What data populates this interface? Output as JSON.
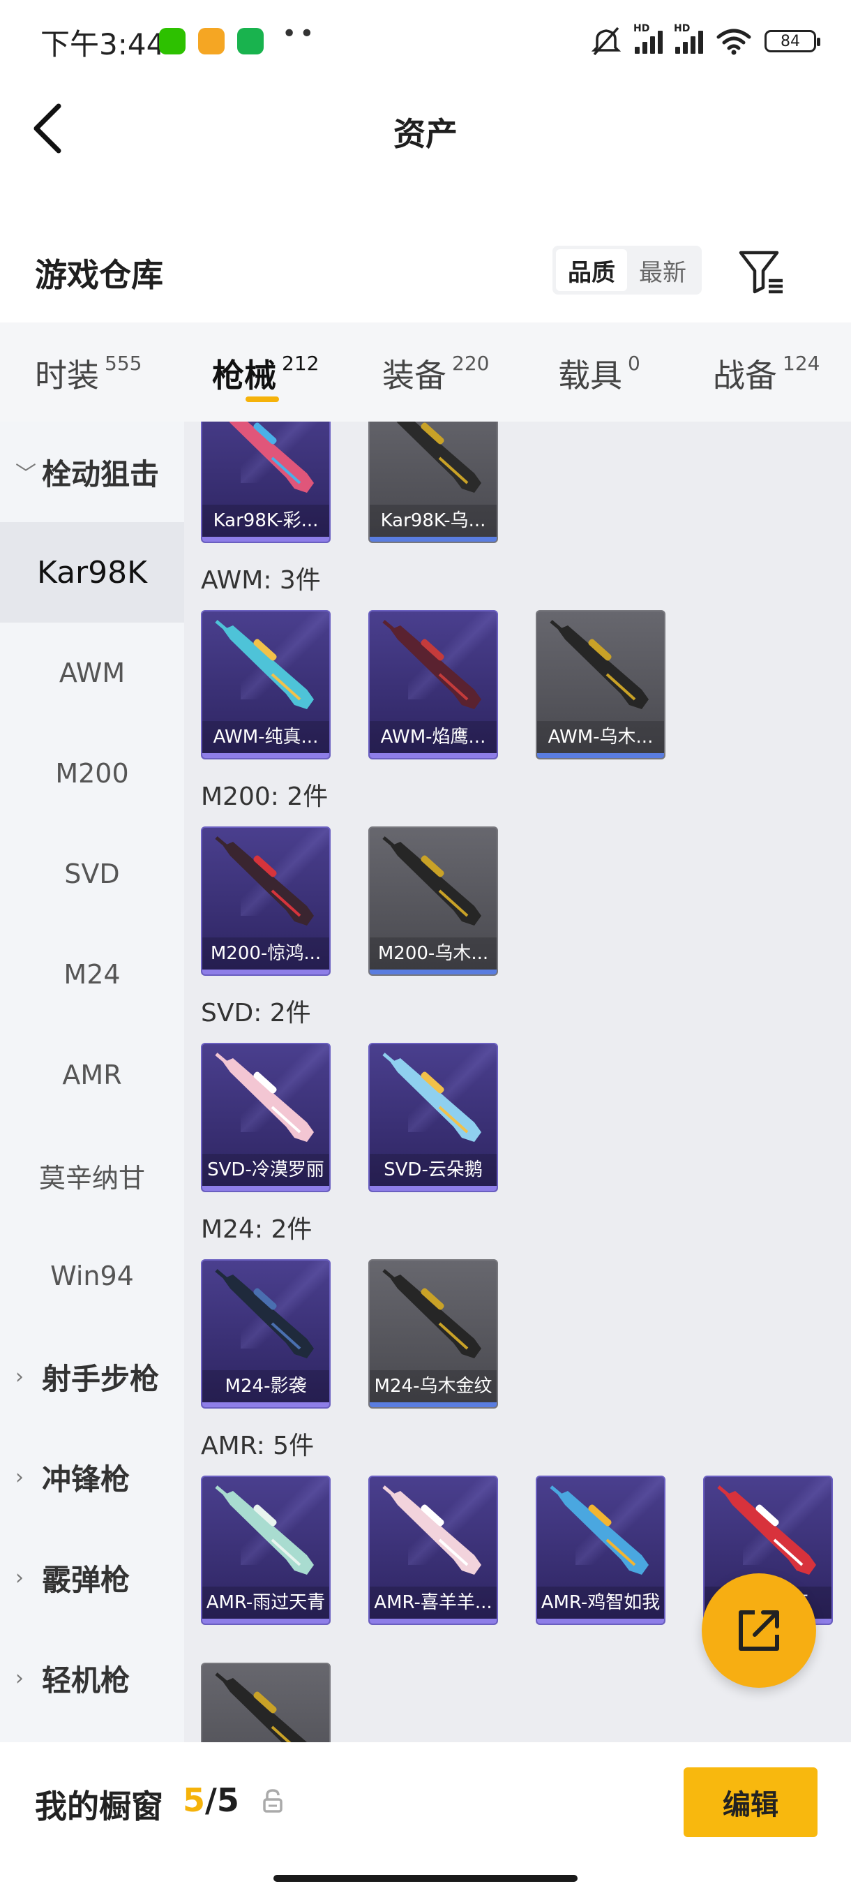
{
  "status_bar": {
    "time": "下午3:44",
    "battery": "84",
    "network_label_1": "HD",
    "network_label_2": "HD",
    "colors": {
      "wechat": "#2dc100",
      "app2": "#f5a623",
      "phone": "#19b34e"
    }
  },
  "header": {
    "title": "资产"
  },
  "warehouse": {
    "title": "游戏仓库",
    "sort_options": [
      "品质",
      "最新"
    ],
    "active_sort": "品质"
  },
  "tabs": [
    {
      "label": "时装",
      "count": "555"
    },
    {
      "label": "枪械",
      "count": "212"
    },
    {
      "label": "装备",
      "count": "220"
    },
    {
      "label": "载具",
      "count": "0"
    },
    {
      "label": "战备",
      "count": "124"
    }
  ],
  "active_tab": "枪械",
  "sidebar": {
    "items": [
      {
        "label": "栓动狙击",
        "type": "group",
        "expanded": true
      },
      {
        "label": "Kar98K",
        "type": "sub",
        "active": true
      },
      {
        "label": "AWM",
        "type": "sub"
      },
      {
        "label": "M200",
        "type": "sub"
      },
      {
        "label": "SVD",
        "type": "sub"
      },
      {
        "label": "M24",
        "type": "sub"
      },
      {
        "label": "AMR",
        "type": "sub"
      },
      {
        "label": "莫辛纳甘",
        "type": "sub"
      },
      {
        "label": "Win94",
        "type": "sub"
      },
      {
        "label": "射手步枪",
        "type": "group"
      },
      {
        "label": "冲锋枪",
        "type": "group"
      },
      {
        "label": "霰弹枪",
        "type": "group"
      },
      {
        "label": "轻机枪",
        "type": "group"
      }
    ]
  },
  "sections": [
    {
      "label": "",
      "items": [
        {
          "name": "Kar98K-彩...",
          "rarity": "purple",
          "gun_color": "#e0567a",
          "accent": "#4ab0e8"
        },
        {
          "name": "Kar98K-乌...",
          "rarity": "gray",
          "gun_color": "#2a2a2a",
          "accent": "#c9a227"
        }
      ]
    },
    {
      "label": "AWM: 3件",
      "items": [
        {
          "name": "AWM-纯真...",
          "rarity": "purple",
          "gun_color": "#4ec3d8",
          "accent": "#f2c14a"
        },
        {
          "name": "AWM-焰鹰...",
          "rarity": "purple",
          "gun_color": "#5a2230",
          "accent": "#c43b3b"
        },
        {
          "name": "AWM-乌木...",
          "rarity": "gray",
          "gun_color": "#262626",
          "accent": "#c9a227"
        }
      ]
    },
    {
      "label": "M200: 2件",
      "items": [
        {
          "name": "M200-惊鸿...",
          "rarity": "purple",
          "gun_color": "#3a2530",
          "accent": "#d6343c"
        },
        {
          "name": "M200-乌木...",
          "rarity": "gray",
          "gun_color": "#262626",
          "accent": "#c9a227"
        }
      ]
    },
    {
      "label": "SVD: 2件",
      "items": [
        {
          "name": "SVD-冷漠罗丽",
          "rarity": "purple",
          "gun_color": "#f3c6d3",
          "accent": "#ffffff"
        },
        {
          "name": "SVD-云朵鹅",
          "rarity": "purple",
          "gun_color": "#8fd0ef",
          "accent": "#f2c14a"
        }
      ]
    },
    {
      "label": "M24: 2件",
      "items": [
        {
          "name": "M24-影袭",
          "rarity": "purple",
          "gun_color": "#1f2a3c",
          "accent": "#4a6fb0"
        },
        {
          "name": "M24-乌木金纹",
          "rarity": "gray",
          "gun_color": "#262626",
          "accent": "#c9a227"
        }
      ]
    },
    {
      "label": "AMR: 5件",
      "items": [
        {
          "name": "AMR-雨过天青",
          "rarity": "purple",
          "gun_color": "#a9dcd0",
          "accent": "#e8f4ef"
        },
        {
          "name": "AMR-喜羊羊...",
          "rarity": "purple",
          "gun_color": "#f2d3dc",
          "accent": "#ffffff"
        },
        {
          "name": "AMR-鸡智如我",
          "rarity": "purple",
          "gun_color": "#4aa7e0",
          "accent": "#f2b531"
        },
        {
          "name": "AMR-...点",
          "rarity": "purple",
          "gun_color": "#d8323c",
          "accent": "#ffffff"
        },
        {
          "name": "",
          "rarity": "gray",
          "gun_color": "#262626",
          "accent": "#c9a227"
        }
      ]
    }
  ],
  "showcase": {
    "label": "我的橱窗",
    "current": "5",
    "separator": "/",
    "total": "5"
  },
  "edit_button": "编辑",
  "icons": {
    "back": "chevron-left-icon",
    "filter": "filter-icon",
    "share": "share-external-icon",
    "lock": "lock-icon"
  }
}
